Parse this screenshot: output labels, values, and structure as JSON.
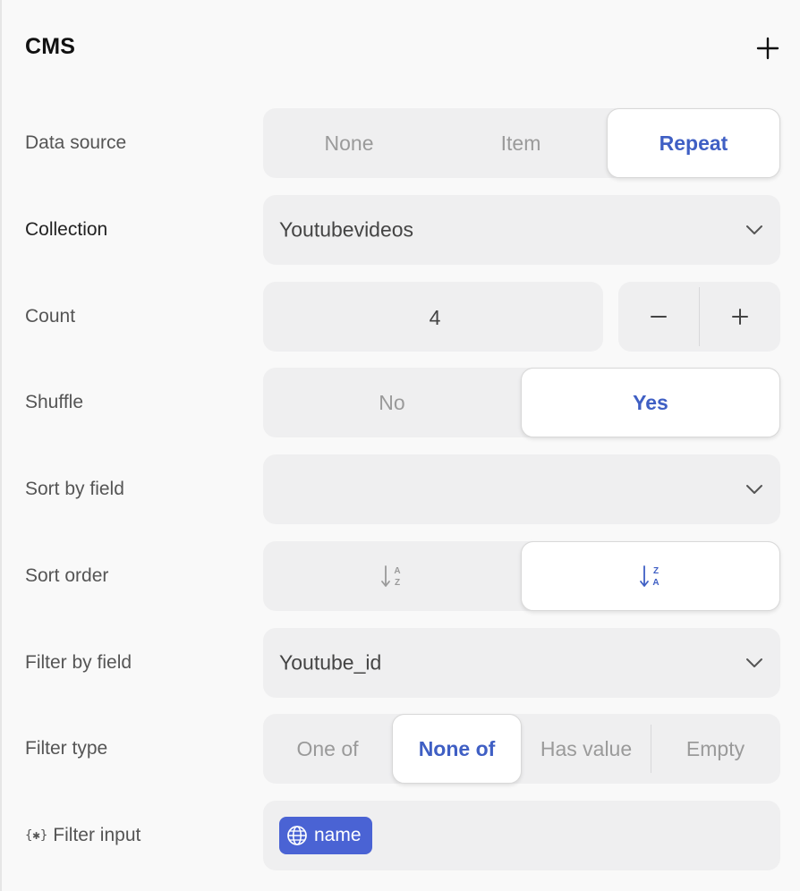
{
  "section": {
    "title": "CMS",
    "add_icon": "plus-icon"
  },
  "rows": {
    "data_source": {
      "label": "Data source",
      "options": [
        "None",
        "Item",
        "Repeat"
      ],
      "selected": "Repeat"
    },
    "collection": {
      "label": "Collection",
      "value": "Youtubevideos",
      "icon": "chevron-down-icon"
    },
    "count": {
      "label": "Count",
      "value": "4",
      "decrement_icon": "minus-icon",
      "increment_icon": "plus-icon"
    },
    "shuffle": {
      "label": "Shuffle",
      "options": [
        "No",
        "Yes"
      ],
      "selected": "Yes"
    },
    "sort_by_field": {
      "label": "Sort by field",
      "value": "",
      "icon": "chevron-down-icon"
    },
    "sort_order": {
      "label": "Sort order",
      "options": [
        "sort-ascending-az-icon",
        "sort-descending-za-icon"
      ],
      "selected": "sort-descending-za-icon"
    },
    "filter_by_field": {
      "label": "Filter by field",
      "value": "Youtube_id",
      "icon": "chevron-down-icon"
    },
    "filter_type": {
      "label": "Filter type",
      "options": [
        "One of",
        "None of",
        "Has value",
        "Empty"
      ],
      "selected": "None of"
    },
    "filter_input": {
      "label": "Filter input",
      "label_icon": "variable-icon",
      "label_icon_glyph": "{✱}",
      "token": {
        "label": "name",
        "icon": "globe-icon"
      }
    }
  },
  "colors": {
    "accent": "#3f5fc4",
    "token_bg": "#4a63d4",
    "control_bg": "#efeff0",
    "panel_bg": "#f9f9f9"
  }
}
